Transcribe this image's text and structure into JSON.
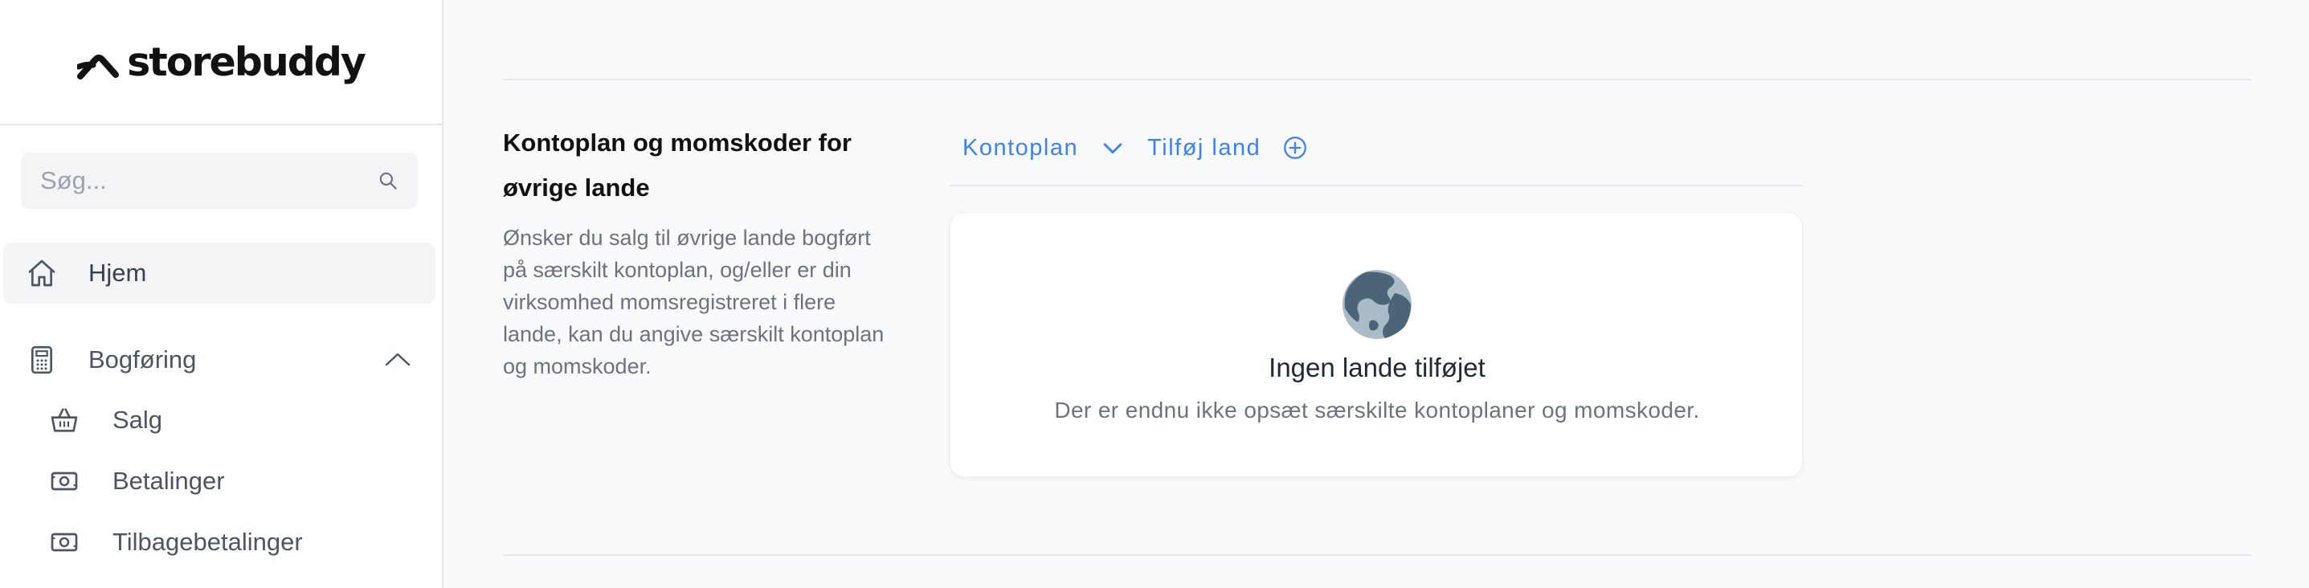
{
  "brand": {
    "name": "storebuddy"
  },
  "search": {
    "placeholder": "Søg..."
  },
  "nav": {
    "home": {
      "label": "Hjem",
      "icon": "home-icon"
    },
    "bogforing": {
      "label": "Bogføring",
      "icon": "calculator-icon",
      "expanded": true
    },
    "sub_items": [
      {
        "label": "Salg",
        "icon": "basket-icon"
      },
      {
        "label": "Betalinger",
        "icon": "banknote-icon"
      },
      {
        "label": "Tilbagebetalinger",
        "icon": "banknote-icon"
      }
    ]
  },
  "section": {
    "title": "Kontoplan og momskoder for øvrige lande",
    "description": "Ønsker du salg til øvrige lande bogført på særskilt kontoplan, og/eller er din virksomhed momsregistreret i flere lande, kan du angive særskilt kontoplan og momskoder."
  },
  "tabs": {
    "kontoplan": {
      "label": "Kontoplan",
      "icon": "chevron-down-icon"
    },
    "add_country": {
      "label": "Tilføj land",
      "icon": "plus-circle-icon"
    }
  },
  "empty_state": {
    "icon": "globe-icon",
    "title": "Ingen lande tilføjet",
    "description": "Der er endnu ikke opsæt særskilte kontoplaner og momskoder."
  },
  "colors": {
    "accent": "#3b82f6",
    "globe": "#4b6478",
    "globe_light": "#a9bcc8"
  }
}
